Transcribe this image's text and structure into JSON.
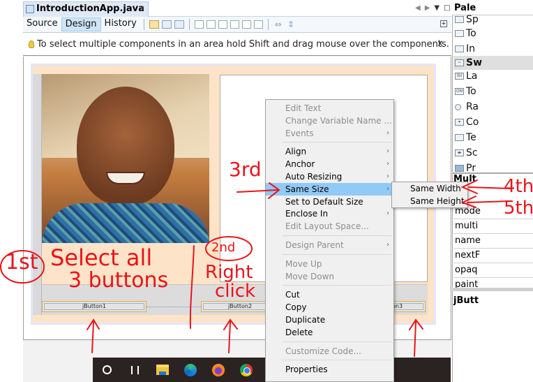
{
  "editor": {
    "file_tab": {
      "label": "IntroductionApp.java",
      "close": "×"
    },
    "modes": [
      {
        "label": "Source",
        "active": false
      },
      {
        "label": "Design",
        "active": true
      },
      {
        "label": "History",
        "active": false
      }
    ],
    "toolbar_icons": [
      "selection-mode-icon",
      "connection-mode-icon",
      "preview-design-icon",
      "align-left-icon",
      "align-right-icon",
      "center-horizontally-icon",
      "align-top-icon",
      "align-bottom-icon",
      "center-vertically-icon",
      "resize-horizontal-icon",
      "resize-vertical-icon"
    ],
    "hint": {
      "text": "To select multiple components in an area hold Shift and drag mouse over the components.",
      "close": "x"
    }
  },
  "form": {
    "buttons": [
      {
        "label": "jButton1"
      },
      {
        "label": "jButton2"
      },
      {
        "label": "on3"
      }
    ]
  },
  "palette": {
    "title": "Pale",
    "items": [
      {
        "label": "Sp",
        "icon": "split-pane-icon",
        "category": false
      },
      {
        "label": "To",
        "icon": "tool-bar-icon",
        "category": false
      },
      {
        "label": "In",
        "icon": "internal-frame-icon",
        "category": false
      },
      {
        "label": "Sw",
        "icon": "collapse-icon",
        "category": true
      },
      {
        "label": "La",
        "icon": "label-icon",
        "category": false
      },
      {
        "label": "To",
        "icon": "toggle-button-icon",
        "category": false
      },
      {
        "label": "Ra",
        "icon": "radio-button-icon",
        "category": false
      },
      {
        "label": "Co",
        "icon": "combo-box-icon",
        "category": false
      },
      {
        "label": "Te",
        "icon": "text-field-icon",
        "category": false
      },
      {
        "label": "Sc",
        "icon": "scroll-bar-icon",
        "category": false
      },
      {
        "label": "Pr",
        "icon": "progress-bar-icon",
        "category": false
      }
    ]
  },
  "properties": {
    "title": "Mult",
    "rows": [
      "mode",
      "multi",
      "name",
      "nextF",
      "opaq",
      "paint"
    ],
    "inspector_title": "jButt"
  },
  "context_menu": {
    "items": [
      {
        "label": "Edit Text",
        "disabled": true,
        "submenu": false
      },
      {
        "label": "Change Variable Name ...",
        "disabled": true,
        "submenu": false
      },
      {
        "label": "Events",
        "disabled": true,
        "submenu": true
      },
      {
        "separator": true
      },
      {
        "label": "Align",
        "disabled": false,
        "submenu": true
      },
      {
        "label": "Anchor",
        "disabled": false,
        "submenu": true
      },
      {
        "label": "Auto Resizing",
        "disabled": false,
        "submenu": true
      },
      {
        "label": "Same Size",
        "disabled": false,
        "submenu": true,
        "highlighted": true
      },
      {
        "label": "Set to Default Size",
        "disabled": false,
        "submenu": false
      },
      {
        "label": "Enclose In",
        "disabled": false,
        "submenu": true
      },
      {
        "label": "Edit Layout Space...",
        "disabled": true,
        "submenu": false
      },
      {
        "separator": true
      },
      {
        "label": "Design Parent",
        "disabled": true,
        "submenu": true
      },
      {
        "separator": true
      },
      {
        "label": "Move Up",
        "disabled": true,
        "submenu": false
      },
      {
        "label": "Move Down",
        "disabled": true,
        "submenu": false
      },
      {
        "separator": true
      },
      {
        "label": "Cut",
        "disabled": false,
        "submenu": false
      },
      {
        "label": "Copy",
        "disabled": false,
        "submenu": false
      },
      {
        "label": "Duplicate",
        "disabled": false,
        "submenu": false
      },
      {
        "label": "Delete",
        "disabled": false,
        "submenu": false
      },
      {
        "separator": true
      },
      {
        "label": "Customize Code...",
        "disabled": true,
        "submenu": false
      },
      {
        "separator": true
      },
      {
        "label": "Properties",
        "disabled": false,
        "submenu": false
      }
    ],
    "submenu_arrow": "›"
  },
  "submenu": {
    "items": [
      {
        "label": "Same Width"
      },
      {
        "label": "Same Height"
      }
    ]
  },
  "taskbar": {
    "icons": [
      "cortana-icon",
      "task-view-icon",
      "file-explorer-icon",
      "edge-icon",
      "firefox-icon",
      "chrome-icon"
    ]
  },
  "annotations": {
    "step1_circle": "1st",
    "step1_text_line1": "Select all",
    "step1_text_line2": "3 buttons",
    "step2_circle": "2nd",
    "step2_text_line1": "Right",
    "step2_text_line2": "click",
    "step3": "3rd",
    "step4": "4th",
    "step5": "5th",
    "color": "#e8141b"
  },
  "colors": {
    "menu_highlight": "#91c9f7",
    "selection_border": "#e8a93a",
    "form_background": "#fde3c8",
    "taskbar": "#2b2321"
  }
}
